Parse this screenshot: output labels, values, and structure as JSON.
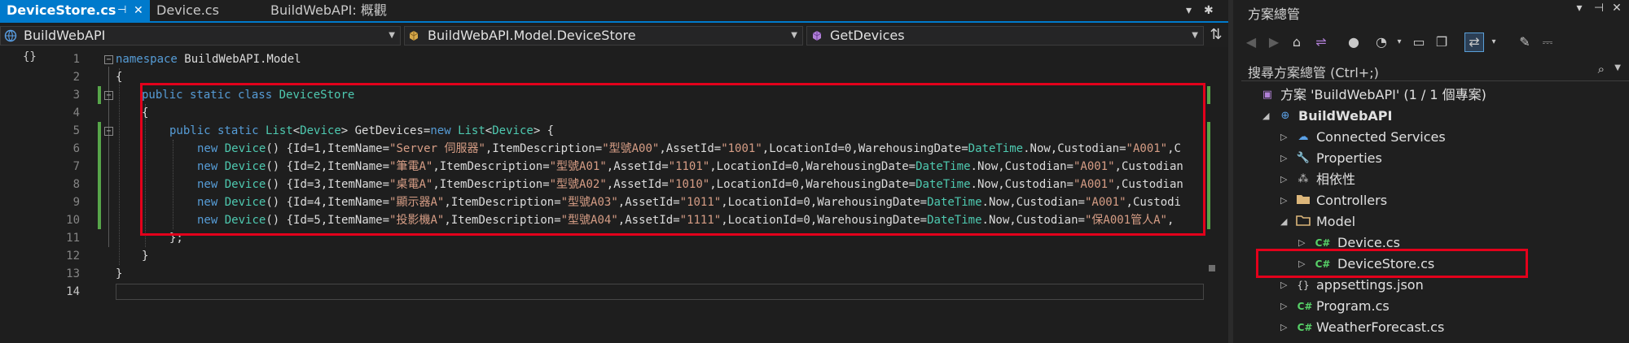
{
  "tabs": [
    {
      "label": "DeviceStore.cs",
      "active": true
    },
    {
      "label": "Device.cs",
      "active": false
    },
    {
      "label": "BuildWebAPI: 概觀",
      "active": false
    }
  ],
  "tab_pin": "⊣",
  "tab_close": "✕",
  "tabbar_right": {
    "dropdown": "▾",
    "settings": "✱"
  },
  "nav": {
    "project": "BuildWebAPI",
    "type": "BuildWebAPI.Model.DeviceStore",
    "member": "GetDevices"
  },
  "code_lines": [
    {
      "n": "1",
      "parts": [
        {
          "c": "k",
          "t": "namespace"
        },
        {
          "c": "n",
          "t": " BuildWebAPI.Model"
        }
      ]
    },
    {
      "n": "2",
      "parts": [
        {
          "c": "p",
          "t": "{"
        }
      ]
    },
    {
      "n": "3",
      "parts": [
        {
          "c": "k",
          "t": "public static class"
        },
        {
          "c": "t",
          "t": " DeviceStore"
        }
      ]
    },
    {
      "n": "4",
      "parts": [
        {
          "c": "p",
          "t": "{"
        }
      ]
    },
    {
      "n": "5",
      "parts": [
        {
          "c": "k",
          "t": "public static"
        },
        {
          "c": "t",
          "t": " List"
        },
        {
          "c": "p",
          "t": "<"
        },
        {
          "c": "t",
          "t": "Device"
        },
        {
          "c": "p",
          "t": "> "
        },
        {
          "c": "m",
          "t": "GetDevices"
        },
        {
          "c": "p",
          "t": "="
        },
        {
          "c": "k",
          "t": "new"
        },
        {
          "c": "t",
          "t": " List"
        },
        {
          "c": "p",
          "t": "<"
        },
        {
          "c": "t",
          "t": "Device"
        },
        {
          "c": "p",
          "t": "> {"
        }
      ]
    },
    {
      "n": "6",
      "parts": [
        {
          "c": "k",
          "t": "new"
        },
        {
          "c": "t",
          "t": " Device"
        },
        {
          "c": "p",
          "t": "() {Id=1,ItemName="
        },
        {
          "c": "s",
          "t": "\"Server 伺服器\""
        },
        {
          "c": "p",
          "t": ",ItemDescription="
        },
        {
          "c": "s",
          "t": "\"型號A00\""
        },
        {
          "c": "p",
          "t": ",AssetId="
        },
        {
          "c": "s",
          "t": "\"1001\""
        },
        {
          "c": "p",
          "t": ",LocationId=0,WarehousingDate="
        },
        {
          "c": "u",
          "t": "DateTime"
        },
        {
          "c": "p",
          "t": ".Now,Custodian="
        },
        {
          "c": "s",
          "t": "\"A001\""
        },
        {
          "c": "p",
          "t": ",C"
        }
      ]
    },
    {
      "n": "7",
      "parts": [
        {
          "c": "k",
          "t": "new"
        },
        {
          "c": "t",
          "t": " Device"
        },
        {
          "c": "p",
          "t": "() {Id=2,ItemName="
        },
        {
          "c": "s",
          "t": "\"筆電A\""
        },
        {
          "c": "p",
          "t": ",ItemDescription="
        },
        {
          "c": "s",
          "t": "\"型號A01\""
        },
        {
          "c": "p",
          "t": ",AssetId="
        },
        {
          "c": "s",
          "t": "\"1101\""
        },
        {
          "c": "p",
          "t": ",LocationId=0,WarehousingDate="
        },
        {
          "c": "u",
          "t": "DateTime"
        },
        {
          "c": "p",
          "t": ".Now,Custodian="
        },
        {
          "c": "s",
          "t": "\"A001\""
        },
        {
          "c": "p",
          "t": ",Custodian"
        }
      ]
    },
    {
      "n": "8",
      "parts": [
        {
          "c": "k",
          "t": "new"
        },
        {
          "c": "t",
          "t": " Device"
        },
        {
          "c": "p",
          "t": "() {Id=3,ItemName="
        },
        {
          "c": "s",
          "t": "\"桌電A\""
        },
        {
          "c": "p",
          "t": ",ItemDescription="
        },
        {
          "c": "s",
          "t": "\"型號A02\""
        },
        {
          "c": "p",
          "t": ",AssetId="
        },
        {
          "c": "s",
          "t": "\"1010\""
        },
        {
          "c": "p",
          "t": ",LocationId=0,WarehousingDate="
        },
        {
          "c": "u",
          "t": "DateTime"
        },
        {
          "c": "p",
          "t": ".Now,Custodian="
        },
        {
          "c": "s",
          "t": "\"A001\""
        },
        {
          "c": "p",
          "t": ",Custodian"
        }
      ]
    },
    {
      "n": "9",
      "parts": [
        {
          "c": "k",
          "t": "new"
        },
        {
          "c": "t",
          "t": " Device"
        },
        {
          "c": "p",
          "t": "() {Id=4,ItemName="
        },
        {
          "c": "s",
          "t": "\"顯示器A\""
        },
        {
          "c": "p",
          "t": ",ItemDescription="
        },
        {
          "c": "s",
          "t": "\"型號A03\""
        },
        {
          "c": "p",
          "t": ",AssetId="
        },
        {
          "c": "s",
          "t": "\"1011\""
        },
        {
          "c": "p",
          "t": ",LocationId=0,WarehousingDate="
        },
        {
          "c": "u",
          "t": "DateTime"
        },
        {
          "c": "p",
          "t": ".Now,Custodian="
        },
        {
          "c": "s",
          "t": "\"A001\""
        },
        {
          "c": "p",
          "t": ",Custodi"
        }
      ]
    },
    {
      "n": "10",
      "parts": [
        {
          "c": "k",
          "t": "new"
        },
        {
          "c": "t",
          "t": " Device"
        },
        {
          "c": "p",
          "t": "() {Id=5,ItemName="
        },
        {
          "c": "s",
          "t": "\"投影機A\""
        },
        {
          "c": "p",
          "t": ",ItemDescription="
        },
        {
          "c": "s",
          "t": "\"型號A04\""
        },
        {
          "c": "p",
          "t": ",AssetId="
        },
        {
          "c": "s",
          "t": "\"1111\""
        },
        {
          "c": "p",
          "t": ",LocationId=0,WarehousingDate="
        },
        {
          "c": "u",
          "t": "DateTime"
        },
        {
          "c": "p",
          "t": ".Now,Custodian="
        },
        {
          "c": "s",
          "t": "\"保A001管人A\""
        },
        {
          "c": "p",
          "t": ","
        }
      ]
    },
    {
      "n": "11",
      "parts": [
        {
          "c": "p",
          "t": "};"
        }
      ]
    },
    {
      "n": "12",
      "parts": [
        {
          "c": "p",
          "t": "}"
        }
      ]
    },
    {
      "n": "13",
      "parts": [
        {
          "c": "p",
          "t": "}"
        }
      ]
    },
    {
      "n": "14",
      "parts": []
    }
  ],
  "solution_explorer": {
    "title": "方案總管",
    "title_buttons": {
      "dropdown": "▾",
      "pin": "⊣",
      "close": "✕"
    },
    "search_placeholder": "搜尋方案總管 (Ctrl+;)",
    "search_icon": "⌕",
    "tree": [
      {
        "label": "方案 'BuildWebAPI' (1 / 1 個專案)",
        "icon": "solution-icon"
      },
      {
        "label": "BuildWebAPI",
        "icon": "web-project-icon",
        "bold": true
      },
      {
        "label": "Connected Services",
        "icon": "connected-services-icon"
      },
      {
        "label": "Properties",
        "icon": "properties-icon"
      },
      {
        "label": "相依性",
        "icon": "dependencies-icon"
      },
      {
        "label": "Controllers",
        "icon": "folder-icon"
      },
      {
        "label": "Model",
        "icon": "folder-icon"
      },
      {
        "label": "Device.cs",
        "icon": "csharp-file-icon"
      },
      {
        "label": "DeviceStore.cs",
        "icon": "csharp-file-icon"
      },
      {
        "label": "appsettings.json",
        "icon": "json-file-icon"
      },
      {
        "label": "Program.cs",
        "icon": "csharp-file-icon"
      },
      {
        "label": "WeatherForecast.cs",
        "icon": "csharp-file-icon"
      }
    ],
    "csharp_glyph": "C#",
    "json_glyph": "{}"
  },
  "colors": {
    "accent": "#007acc",
    "highlight_red": "#e3001b",
    "keyword": "#569cd6",
    "type": "#4ec9b0",
    "string": "#d69d85",
    "line_number": "#858585",
    "change_green": "#57a64a"
  }
}
